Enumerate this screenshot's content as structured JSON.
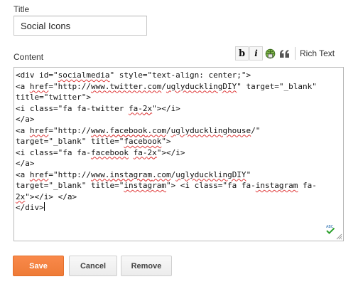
{
  "form": {
    "title_label": "Title",
    "title_value": "Social Icons",
    "content_label": "Content"
  },
  "toolbar": {
    "bold_label": "b",
    "italic_label": "i",
    "link_icon": "link-globe-icon",
    "quote_label": "❝",
    "rich_text_label": "Rich Text"
  },
  "editor": {
    "lines": [
      "<div id=\"socialmedia\" style=\"text-align: center;\">",
      "<a href=\"http://www.twitter.com/uglyducklingDIY\" target=\"_blank\"",
      "title=\"twitter\">",
      "<i class=\"fa fa-twitter fa-2x\"></i>",
      "</a>",
      "<a href=\"http://www.facebook.com/uglyducklinghouse/\"",
      "target=\"_blank\" title=\"facebook\">",
      "<i class=\"fa fa-facebook fa-2x\"></i>",
      "</a>",
      "<a href=\"http://www.instagram.com/uglyducklingDIY\"",
      "target=\"_blank\" title=\"instagram\"> <i class=\"fa fa-instagram fa-",
      "2x\"></i> </a>",
      "</div>"
    ],
    "spellcheck_icon": "spellcheck-icon"
  },
  "buttons": {
    "save": "Save",
    "cancel": "Cancel",
    "remove": "Remove"
  },
  "colors": {
    "save_button": "#f4844a",
    "spell_underline": "#e03c3c"
  }
}
